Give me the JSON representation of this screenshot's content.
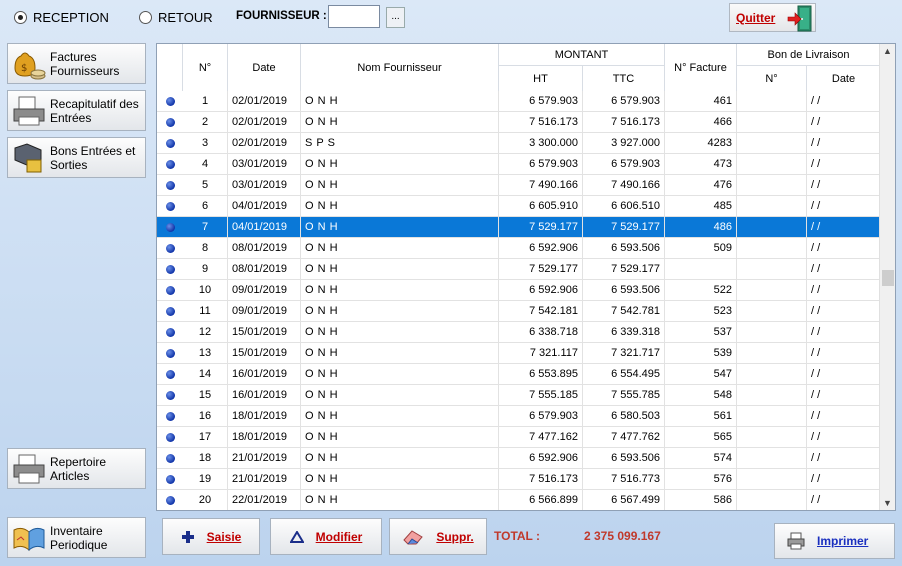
{
  "top": {
    "reception_label": "RECEPTION",
    "retour_label": "RETOUR",
    "fournisseur_label": "FOURNISSEUR :",
    "fournisseur_value": "",
    "browse_label": "...",
    "quit_label": "Quitter"
  },
  "sidebar": {
    "factures": "Factures Fournisseurs",
    "recap": "Recapitulatif des Entrées",
    "bons": "Bons Entrées et Sorties",
    "repertoire": "Repertoire Articles",
    "inventaire": "Inventaire Periodique"
  },
  "grid": {
    "headers": {
      "num": "N°",
      "date": "Date",
      "nom": "Nom Fournisseur",
      "montant": "MONTANT",
      "ht": "HT",
      "ttc": "TTC",
      "facture": "N° Facture",
      "bon": "Bon de Livraison",
      "bon_num": "N°",
      "bon_date": "Date"
    },
    "rows": [
      {
        "num": "1",
        "date": "02/01/2019",
        "nom": "O N H",
        "ht": "6 579.903",
        "ttc": "6 579.903",
        "fac": "461",
        "bln": "",
        "bld": "/ /"
      },
      {
        "num": "2",
        "date": "02/01/2019",
        "nom": "O N H",
        "ht": "7 516.173",
        "ttc": "7 516.173",
        "fac": "466",
        "bln": "",
        "bld": "/ /"
      },
      {
        "num": "3",
        "date": "02/01/2019",
        "nom": "S P S",
        "ht": "3 300.000",
        "ttc": "3 927.000",
        "fac": "4283",
        "bln": "",
        "bld": "/ /"
      },
      {
        "num": "4",
        "date": "03/01/2019",
        "nom": "O N H",
        "ht": "6 579.903",
        "ttc": "6 579.903",
        "fac": "473",
        "bln": "",
        "bld": "/ /"
      },
      {
        "num": "5",
        "date": "03/01/2019",
        "nom": "O N H",
        "ht": "7 490.166",
        "ttc": "7 490.166",
        "fac": "476",
        "bln": "",
        "bld": "/ /"
      },
      {
        "num": "6",
        "date": "04/01/2019",
        "nom": "O N H",
        "ht": "6 605.910",
        "ttc": "6 606.510",
        "fac": "485",
        "bln": "",
        "bld": "/ /"
      },
      {
        "num": "7",
        "date": "04/01/2019",
        "nom": "O N H",
        "ht": "7 529.177",
        "ttc": "7 529.177",
        "fac": "486",
        "bln": "",
        "bld": "/ /"
      },
      {
        "num": "8",
        "date": "08/01/2019",
        "nom": "O N H",
        "ht": "6 592.906",
        "ttc": "6 593.506",
        "fac": "509",
        "bln": "",
        "bld": "/ /"
      },
      {
        "num": "9",
        "date": "08/01/2019",
        "nom": "O N H",
        "ht": "7 529.177",
        "ttc": "7 529.177",
        "fac": "",
        "bln": "",
        "bld": "/ /"
      },
      {
        "num": "10",
        "date": "09/01/2019",
        "nom": "O N H",
        "ht": "6 592.906",
        "ttc": "6 593.506",
        "fac": "522",
        "bln": "",
        "bld": "/ /"
      },
      {
        "num": "11",
        "date": "09/01/2019",
        "nom": "O N H",
        "ht": "7 542.181",
        "ttc": "7 542.781",
        "fac": "523",
        "bln": "",
        "bld": "/ /"
      },
      {
        "num": "12",
        "date": "15/01/2019",
        "nom": "O N H",
        "ht": "6 338.718",
        "ttc": "6 339.318",
        "fac": "537",
        "bln": "",
        "bld": "/ /"
      },
      {
        "num": "13",
        "date": "15/01/2019",
        "nom": "O N H",
        "ht": "7 321.117",
        "ttc": "7 321.717",
        "fac": "539",
        "bln": "",
        "bld": "/ /"
      },
      {
        "num": "14",
        "date": "16/01/2019",
        "nom": "O N H",
        "ht": "6 553.895",
        "ttc": "6 554.495",
        "fac": "547",
        "bln": "",
        "bld": "/ /"
      },
      {
        "num": "15",
        "date": "16/01/2019",
        "nom": "O N H",
        "ht": "7 555.185",
        "ttc": "7 555.785",
        "fac": "548",
        "bln": "",
        "bld": "/ /"
      },
      {
        "num": "16",
        "date": "18/01/2019",
        "nom": "O N H",
        "ht": "6 579.903",
        "ttc": "6 580.503",
        "fac": "561",
        "bln": "",
        "bld": "/ /"
      },
      {
        "num": "17",
        "date": "18/01/2019",
        "nom": "O N H",
        "ht": "7 477.162",
        "ttc": "7 477.762",
        "fac": "565",
        "bln": "",
        "bld": "/ /"
      },
      {
        "num": "18",
        "date": "21/01/2019",
        "nom": "O N H",
        "ht": "6 592.906",
        "ttc": "6 593.506",
        "fac": "574",
        "bln": "",
        "bld": "/ /"
      },
      {
        "num": "19",
        "date": "21/01/2019",
        "nom": "O N H",
        "ht": "7 516.173",
        "ttc": "7 516.773",
        "fac": "576",
        "bln": "",
        "bld": "/ /"
      },
      {
        "num": "20",
        "date": "22/01/2019",
        "nom": "O N H",
        "ht": "6 566.899",
        "ttc": "6 567.499",
        "fac": "586",
        "bln": "",
        "bld": "/ /"
      }
    ],
    "selected_num": "7"
  },
  "bottom": {
    "saisie": "Saisie",
    "modifier": "Modifier",
    "suppr": "Suppr.",
    "total_label": "TOTAL :",
    "total_value": "2 375 099.167",
    "imprimer": "Imprimer"
  },
  "colors": {
    "selection": "#0a78d7",
    "action_text": "#c00000",
    "total_text": "#c0392b",
    "print_text": "#1a2fbf"
  }
}
